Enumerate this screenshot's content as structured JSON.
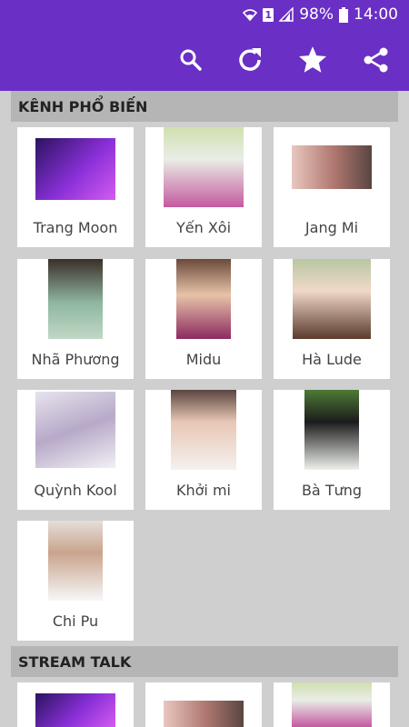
{
  "status_bar": {
    "battery_percent": "98%",
    "time": "14:00",
    "sim_label": "1",
    "icons": [
      "wifi-icon",
      "sim-icon",
      "signal-icon",
      "battery-icon"
    ]
  },
  "toolbar": {
    "icons": [
      "search-icon",
      "refresh-icon",
      "star-icon",
      "share-icon"
    ]
  },
  "sections": [
    {
      "title": "KÊNH PHỔ BIẾN",
      "items": [
        {
          "name": "Trang Moon",
          "thumb_color": "#3a1b6e"
        },
        {
          "name": "Yến Xôi",
          "thumb_color": "#b7d08a"
        },
        {
          "name": "Jang Mi",
          "thumb_color": "#c98f86"
        },
        {
          "name": "Nhã Phương",
          "thumb_color": "#5b4b3c"
        },
        {
          "name": "Midu",
          "thumb_color": "#9c3c6f"
        },
        {
          "name": "Hà Lude",
          "thumb_color": "#d5b8a5"
        },
        {
          "name": "Quỳnh Kool",
          "thumb_color": "#cfc6d6"
        },
        {
          "name": "Khởi mi",
          "thumb_color": "#8a6f6a"
        },
        {
          "name": "Bà Tưng",
          "thumb_color": "#4f7a3b"
        },
        {
          "name": "Chi Pu",
          "thumb_color": "#c9b8a8"
        }
      ]
    },
    {
      "title": "STREAM TALK",
      "items": [
        {
          "name": "",
          "thumb_color": "#3a1b6e"
        },
        {
          "name": "",
          "thumb_color": "#c98f86"
        },
        {
          "name": "",
          "thumb_color": "#b7d08a"
        }
      ]
    }
  ],
  "colors": {
    "primary": "#6a2fc4",
    "background": "#cfcfcf",
    "section_header": "#b5b5b5",
    "card": "#ffffff"
  }
}
